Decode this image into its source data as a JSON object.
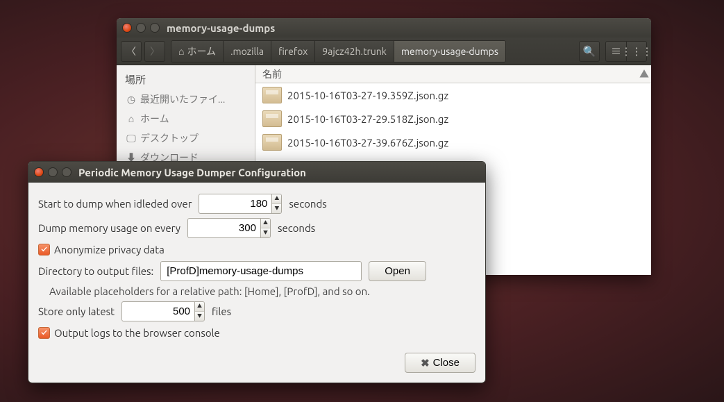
{
  "fm": {
    "title": "memory-usage-dumps",
    "breadcrumb": [
      "ホーム",
      ".mozilla",
      "firefox",
      "9ajcz42h.trunk",
      "memory-usage-dumps"
    ],
    "home_icon": "⌂",
    "sidebar": {
      "header": "場所",
      "items": [
        {
          "icon": "◷",
          "label": "最近開いたファイ..."
        },
        {
          "icon": "⌂",
          "label": "ホーム"
        },
        {
          "icon": "🖵",
          "label": "デスクトップ"
        },
        {
          "icon": "⬇",
          "label": "ダウンロード"
        }
      ]
    },
    "columns": {
      "name": "名前",
      "sort": "▲"
    },
    "files": [
      "2015-10-16T03-27-19.359Z.json.gz",
      "2015-10-16T03-27-29.518Z.json.gz",
      "2015-10-16T03-27-39.676Z.json.gz"
    ]
  },
  "dlg": {
    "title": "Periodic Memory Usage Dumper Configuration",
    "idle_label": "Start to dump when idleded over",
    "idle_value": "180",
    "idle_unit": "seconds",
    "every_label": "Dump memory usage on every",
    "every_value": "300",
    "every_unit": "seconds",
    "anon_label": "Anonymize privacy data",
    "dir_label": "Directory to output files:",
    "dir_value": "[ProfD]memory-usage-dumps",
    "open_label": "Open",
    "hint": "Available placeholders for a relative path: [Home], [ProfD], and so on.",
    "store_label": "Store only latest",
    "store_value": "500",
    "store_unit": "files",
    "log_label": "Output logs to the browser console",
    "close_label": "Close"
  }
}
